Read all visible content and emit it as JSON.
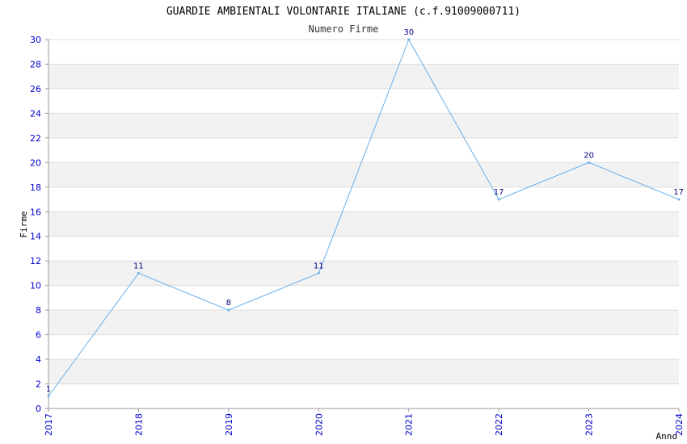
{
  "chart_data": {
    "type": "line",
    "title": "GUARDIE AMBIENTALI VOLONTARIE ITALIANE (c.f.91009000711)",
    "subtitle": "Numero Firme",
    "xlabel": "Anno",
    "ylabel": "Firme",
    "categories": [
      "2017",
      "2018",
      "2019",
      "2020",
      "2021",
      "2022",
      "2023",
      "2024"
    ],
    "series": [
      {
        "values": [
          1,
          11,
          8,
          11,
          30,
          17,
          20,
          17
        ]
      }
    ],
    "ylim": [
      0,
      30
    ],
    "yticks": [
      "0",
      "2",
      "4",
      "6",
      "8",
      "10",
      "12",
      "14",
      "16",
      "18",
      "20",
      "22",
      "24",
      "26",
      "28",
      "30"
    ],
    "grid": true,
    "colors": {
      "line": "#6aaee8",
      "band": "#f2f2f2",
      "tick_text": "#0000cc",
      "data_label": "#000080"
    }
  }
}
